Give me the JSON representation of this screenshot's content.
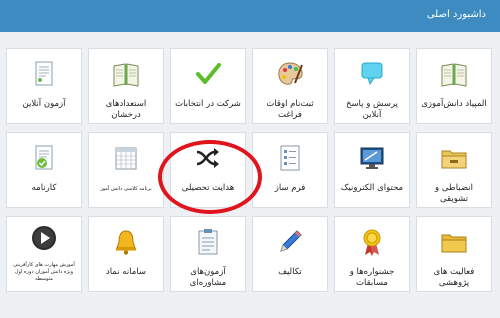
{
  "header": {
    "title": "داشبورد اصلی"
  },
  "rows": [
    [
      {
        "label": "المپیاد دانش‌آموزی",
        "icon": "book-icon"
      },
      {
        "label": "پرسش و پاسخ آنلاین",
        "icon": "chat-bubble-icon"
      },
      {
        "label": "ثبت‌نام اوقات فراغت",
        "icon": "paint-palette-icon"
      },
      {
        "label": "شرکت در انتخابات",
        "icon": "checkmark-icon"
      },
      {
        "label": "استعدادهای درخشان",
        "icon": "book-icon"
      },
      {
        "label": "آزمون آنلاین",
        "icon": "document-icon"
      }
    ],
    [
      {
        "label": "انضباطی و تشویقی",
        "icon": "folder-icon"
      },
      {
        "label": "محتوای الکترونیک",
        "icon": "display-icon"
      },
      {
        "label": "فرم ساز",
        "icon": "form-icon"
      },
      {
        "label": "هدایت تحصیلی",
        "icon": "shuffle-icon"
      },
      {
        "label": "برنامه کلاسی دانش آموز",
        "icon": "calendar-icon"
      },
      {
        "label": "کارنامه",
        "icon": "report-card-icon"
      }
    ],
    [
      {
        "label": "فعالیت های پژوهشی",
        "icon": "folder-icon"
      },
      {
        "label": "جشنواره‌ها و مسابقات",
        "icon": "award-ribbon-icon"
      },
      {
        "label": "تکالیف",
        "icon": "pencil-icon"
      },
      {
        "label": "آزمون‌های مشاوره‌ای",
        "icon": "clipboard-icon"
      },
      {
        "label": "سامانه نماد",
        "icon": "bell-icon"
      },
      {
        "label": "آموزش مهارت های کارآفرینی ویژه دانش آموزان دوره اول متوسطه",
        "icon": "video-play-icon"
      }
    ]
  ],
  "colors": {
    "header": "#3d8bc0",
    "annotation": "#e0141c"
  }
}
